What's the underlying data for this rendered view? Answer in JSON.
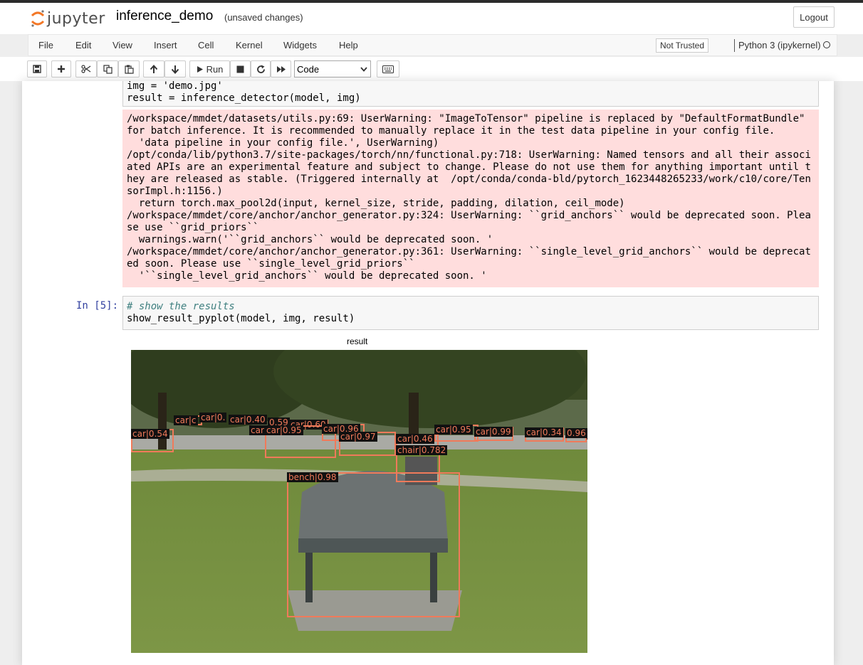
{
  "app": {
    "logo_text": "jupyter",
    "notebook_name": "inference_demo",
    "save_status": "(unsaved changes)",
    "logout_label": "Logout"
  },
  "menu": {
    "items": [
      "File",
      "Edit",
      "View",
      "Insert",
      "Cell",
      "Kernel",
      "Widgets",
      "Help"
    ],
    "trusted_label": "Not Trusted",
    "kernel_name": "Python 3 (ipykernel)"
  },
  "toolbar": {
    "run_label": "Run",
    "cell_type": "Code"
  },
  "cell4": {
    "code_lines": [
      "img = 'demo.jpg'",
      "result = inference_detector(model, img)"
    ],
    "stderr": "/workspace/mmdet/datasets/utils.py:69: UserWarning: \"ImageToTensor\" pipeline is replaced by \"DefaultFormatBundle\"\nfor batch inference. It is recommended to manually replace it in the test data pipeline in your config file.\n  'data pipeline in your config file.', UserWarning)\n/opt/conda/lib/python3.7/site-packages/torch/nn/functional.py:718: UserWarning: Named tensors and all their associ\nated APIs are an experimental feature and subject to change. Please do not use them for anything important until t\nhey are released as stable. (Triggered internally at  /opt/conda/conda-bld/pytorch_1623448265233/work/c10/core/Ten\nsorImpl.h:1156.)\n  return torch.max_pool2d(input, kernel_size, stride, padding, dilation, ceil_mode)\n/workspace/mmdet/core/anchor/anchor_generator.py:324: UserWarning: ``grid_anchors`` would be deprecated soon. Plea\nse use ``grid_priors``\n  warnings.warn('``grid_anchors`` would be deprecated soon. '\n/workspace/mmdet/core/anchor/anchor_generator.py:361: UserWarning: ``single_level_grid_anchors`` would be deprecat\ned soon. Please use ``single_level_grid_priors``\n  '``single_level_grid_anchors`` would be deprecated soon. '"
  },
  "cell5": {
    "prompt": "In [5]:",
    "comment": "# show the results",
    "code": "show_result_pyplot(model, img, result)"
  },
  "figure": {
    "title": "result",
    "detections": [
      {
        "label": "car|0.54"
      },
      {
        "label": "car|c"
      },
      {
        "label": "car|0."
      },
      {
        "label": "car|0.40"
      },
      {
        "label": "0.59"
      },
      {
        "label": "car|0.60"
      },
      {
        "label": "car|"
      },
      {
        "label": "car|0.95"
      },
      {
        "label": "car|0.96"
      },
      {
        "label": "car|0.97"
      },
      {
        "label": "car|0.46"
      },
      {
        "label": "car|0.95"
      },
      {
        "label": "car|0.99"
      },
      {
        "label": "car|0.34"
      },
      {
        "label": "0.96"
      },
      {
        "label": "99"
      },
      {
        "label": "chair|0.782"
      },
      {
        "label": "bench|0.98"
      }
    ]
  },
  "colors": {
    "accent": "#f37726",
    "prompt": "#303f9f",
    "stderr_bg": "#ffdddd",
    "box": "#f07a5a"
  }
}
